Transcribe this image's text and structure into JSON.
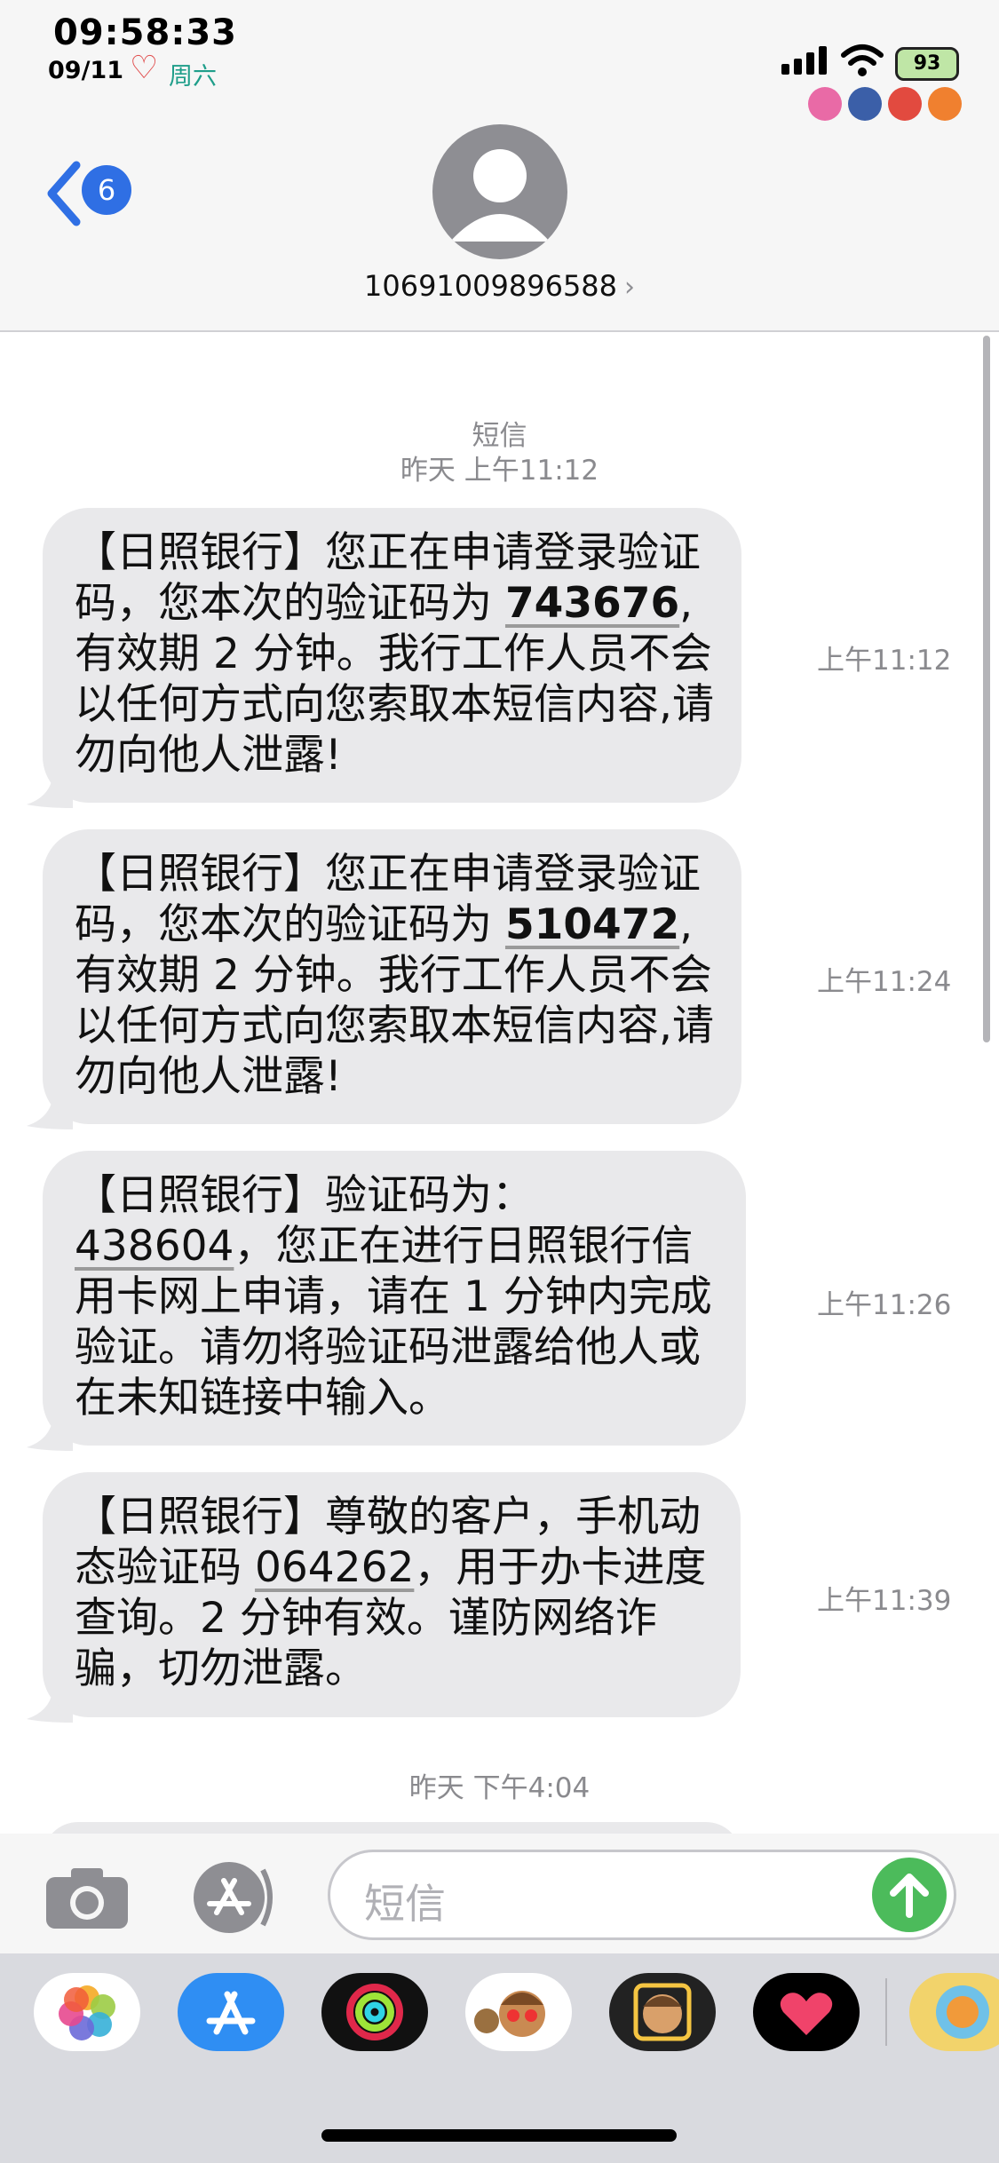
{
  "status_bar": {
    "time": "09:58:33",
    "date": "09/11",
    "heart": "♡",
    "weekday": "周六",
    "battery": "93",
    "icons": [
      "signal-icon",
      "wifi-icon",
      "battery-icon",
      "lock-rotation-icon",
      "alarm-icon",
      "silent-icon",
      "bluetooth-icon"
    ]
  },
  "nav": {
    "back_badge": "6",
    "contact_number": "10691009896588",
    "contact_chevron": "›"
  },
  "conversation": {
    "service_label": "短信",
    "first_timestamp": "昨天 上午11:12",
    "second_timestamp": "昨天 下午4:04",
    "messages": [
      {
        "pre": "【日照银行】您正在申请登录验证码，您本次的验证码为 ",
        "code": "743676",
        "post": ",有效期 2 分钟。我行工作人员不会以任何方式向您索取本短信内容,请勿向他人泄露!",
        "time": "上午11:12"
      },
      {
        "pre": "【日照银行】您正在申请登录验证码，您本次的验证码为 ",
        "code": "510472",
        "post": ",有效期 2 分钟。我行工作人员不会以任何方式向您索取本短信内容,请勿向他人泄露!",
        "time": "上午11:24"
      },
      {
        "pre": "【日照银行】验证码为：",
        "code": "438604",
        "post": "，您正在进行日照银行信用卡网上申请，请在 1 分钟内完成验证。请勿将验证码泄露给他人或在未知链接中输入。",
        "time": "上午11:26"
      },
      {
        "pre": "【日照银行】尊敬的客户，手机动态验证码 ",
        "code": "064262",
        "post": "，用于办卡进度查询。2 分钟有效。谨防网络诈骗，切勿泄露。",
        "time": "上午11:39"
      }
    ]
  },
  "input": {
    "placeholder": "短信",
    "camera_icon": "camera-icon",
    "apps_icon": "app-store-icon",
    "send_icon": "arrow-up-icon"
  },
  "app_drawer": [
    "photos-app-icon",
    "app-store-app-icon",
    "activity-app-icon",
    "memoji-stickers-icon",
    "memoji-icon",
    "digital-touch-icon",
    "game-app-icon"
  ],
  "colors": {
    "bubble": "#e9e9eb",
    "accent_blue": "#2f6fe4",
    "send_green": "#4cbb5b",
    "timestamp_gray": "#8a8a8e"
  }
}
